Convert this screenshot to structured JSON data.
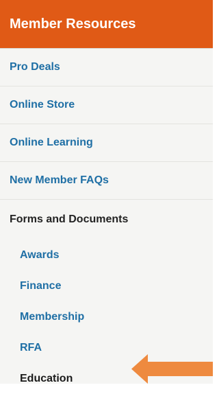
{
  "header": {
    "title": "Member Resources"
  },
  "nav_items": [
    {
      "label": "Pro Deals"
    },
    {
      "label": "Online Store"
    },
    {
      "label": "Online Learning"
    },
    {
      "label": "New Member FAQs"
    }
  ],
  "section": {
    "title": "Forms and Documents",
    "items": [
      {
        "label": "Awards"
      },
      {
        "label": "Finance"
      },
      {
        "label": "Membership"
      },
      {
        "label": "RFA"
      },
      {
        "label": "Education",
        "active": true
      }
    ]
  },
  "colors": {
    "header_bg": "#e05a16",
    "link": "#1f6fa5",
    "active_text": "#1a1a1a",
    "arrow": "#ee8a3f"
  },
  "icons": {
    "pointer": "left-arrow-icon"
  }
}
